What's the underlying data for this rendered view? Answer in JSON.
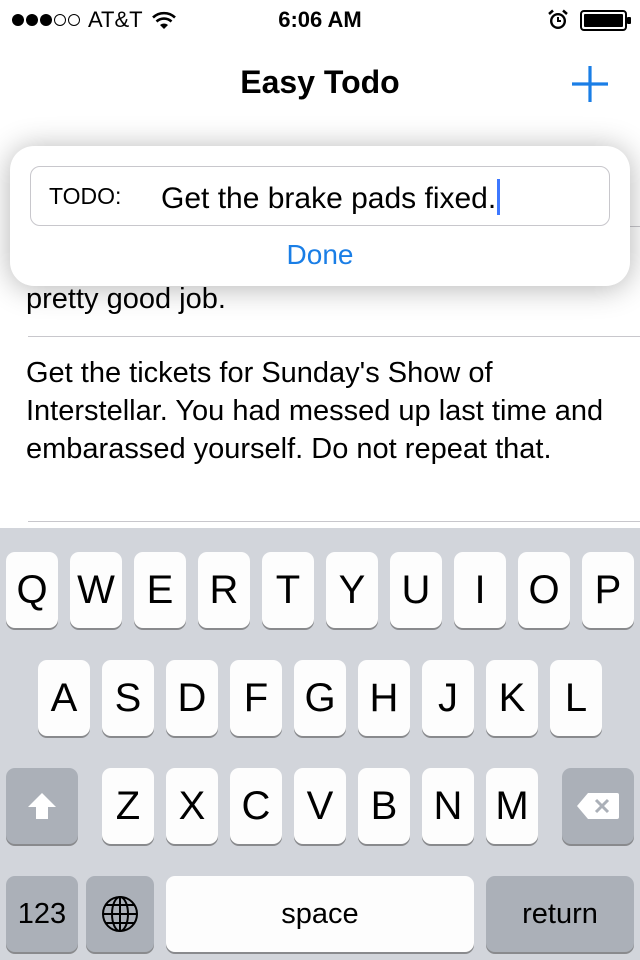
{
  "status_bar": {
    "signal": {
      "filled": 3,
      "total": 5
    },
    "carrier": "AT&T",
    "time": "6:06 AM",
    "icons": [
      "wifi-icon",
      "alarm-icon",
      "battery-icon"
    ]
  },
  "nav": {
    "title": "Easy Todo",
    "add_icon": "plus-icon"
  },
  "list": {
    "rows": [
      {
        "text": "pretty good job."
      },
      {
        "text": "Get the tickets for Sunday's Show of Interstellar. You had messed up last time and embarassed yourself. Do not repeat that."
      }
    ]
  },
  "popover": {
    "field_label": "TODO:",
    "field_value": "Get the brake pads fixed.",
    "done_label": "Done"
  },
  "keyboard": {
    "row1": [
      "Q",
      "W",
      "E",
      "R",
      "T",
      "Y",
      "U",
      "I",
      "O",
      "P"
    ],
    "row2": [
      "A",
      "S",
      "D",
      "F",
      "G",
      "H",
      "J",
      "K",
      "L"
    ],
    "row3": [
      "Z",
      "X",
      "C",
      "V",
      "B",
      "N",
      "M"
    ],
    "numbers_label": "123",
    "space_label": "space",
    "return_label": "return"
  },
  "colors": {
    "accent": "#1a7ee6",
    "keyboard_bg": "#d2d5db",
    "key_dark": "#abb0b8"
  }
}
